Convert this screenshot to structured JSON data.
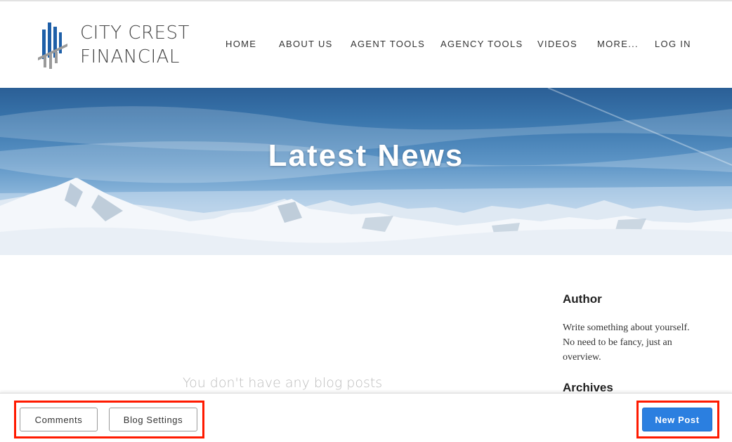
{
  "brand": {
    "line1": "CITY CREST",
    "line2": "FINANCIAL",
    "colors": {
      "blue": "#1e5fa8",
      "gray": "#9a9a9a"
    }
  },
  "nav": {
    "items": [
      {
        "label": "HOME"
      },
      {
        "label": "ABOUT US"
      },
      {
        "label": "AGENT TOOLS"
      },
      {
        "label": "AGENCY TOOLS"
      },
      {
        "label": "VIDEOS"
      },
      {
        "label": "MORE..."
      },
      {
        "label": "LOG IN"
      }
    ]
  },
  "hero": {
    "title": "Latest News"
  },
  "main": {
    "empty_message": "You don't have any blog posts"
  },
  "sidebar": {
    "author_heading": "Author",
    "author_text": "Write something about yourself. No need to be fancy, just an overview.",
    "archives_heading": "Archives"
  },
  "toolbar": {
    "comments_label": "Comments",
    "settings_label": "Blog Settings",
    "new_post_label": "New Post",
    "accent": "#2b7fe0",
    "highlight": "#ff1a00"
  }
}
